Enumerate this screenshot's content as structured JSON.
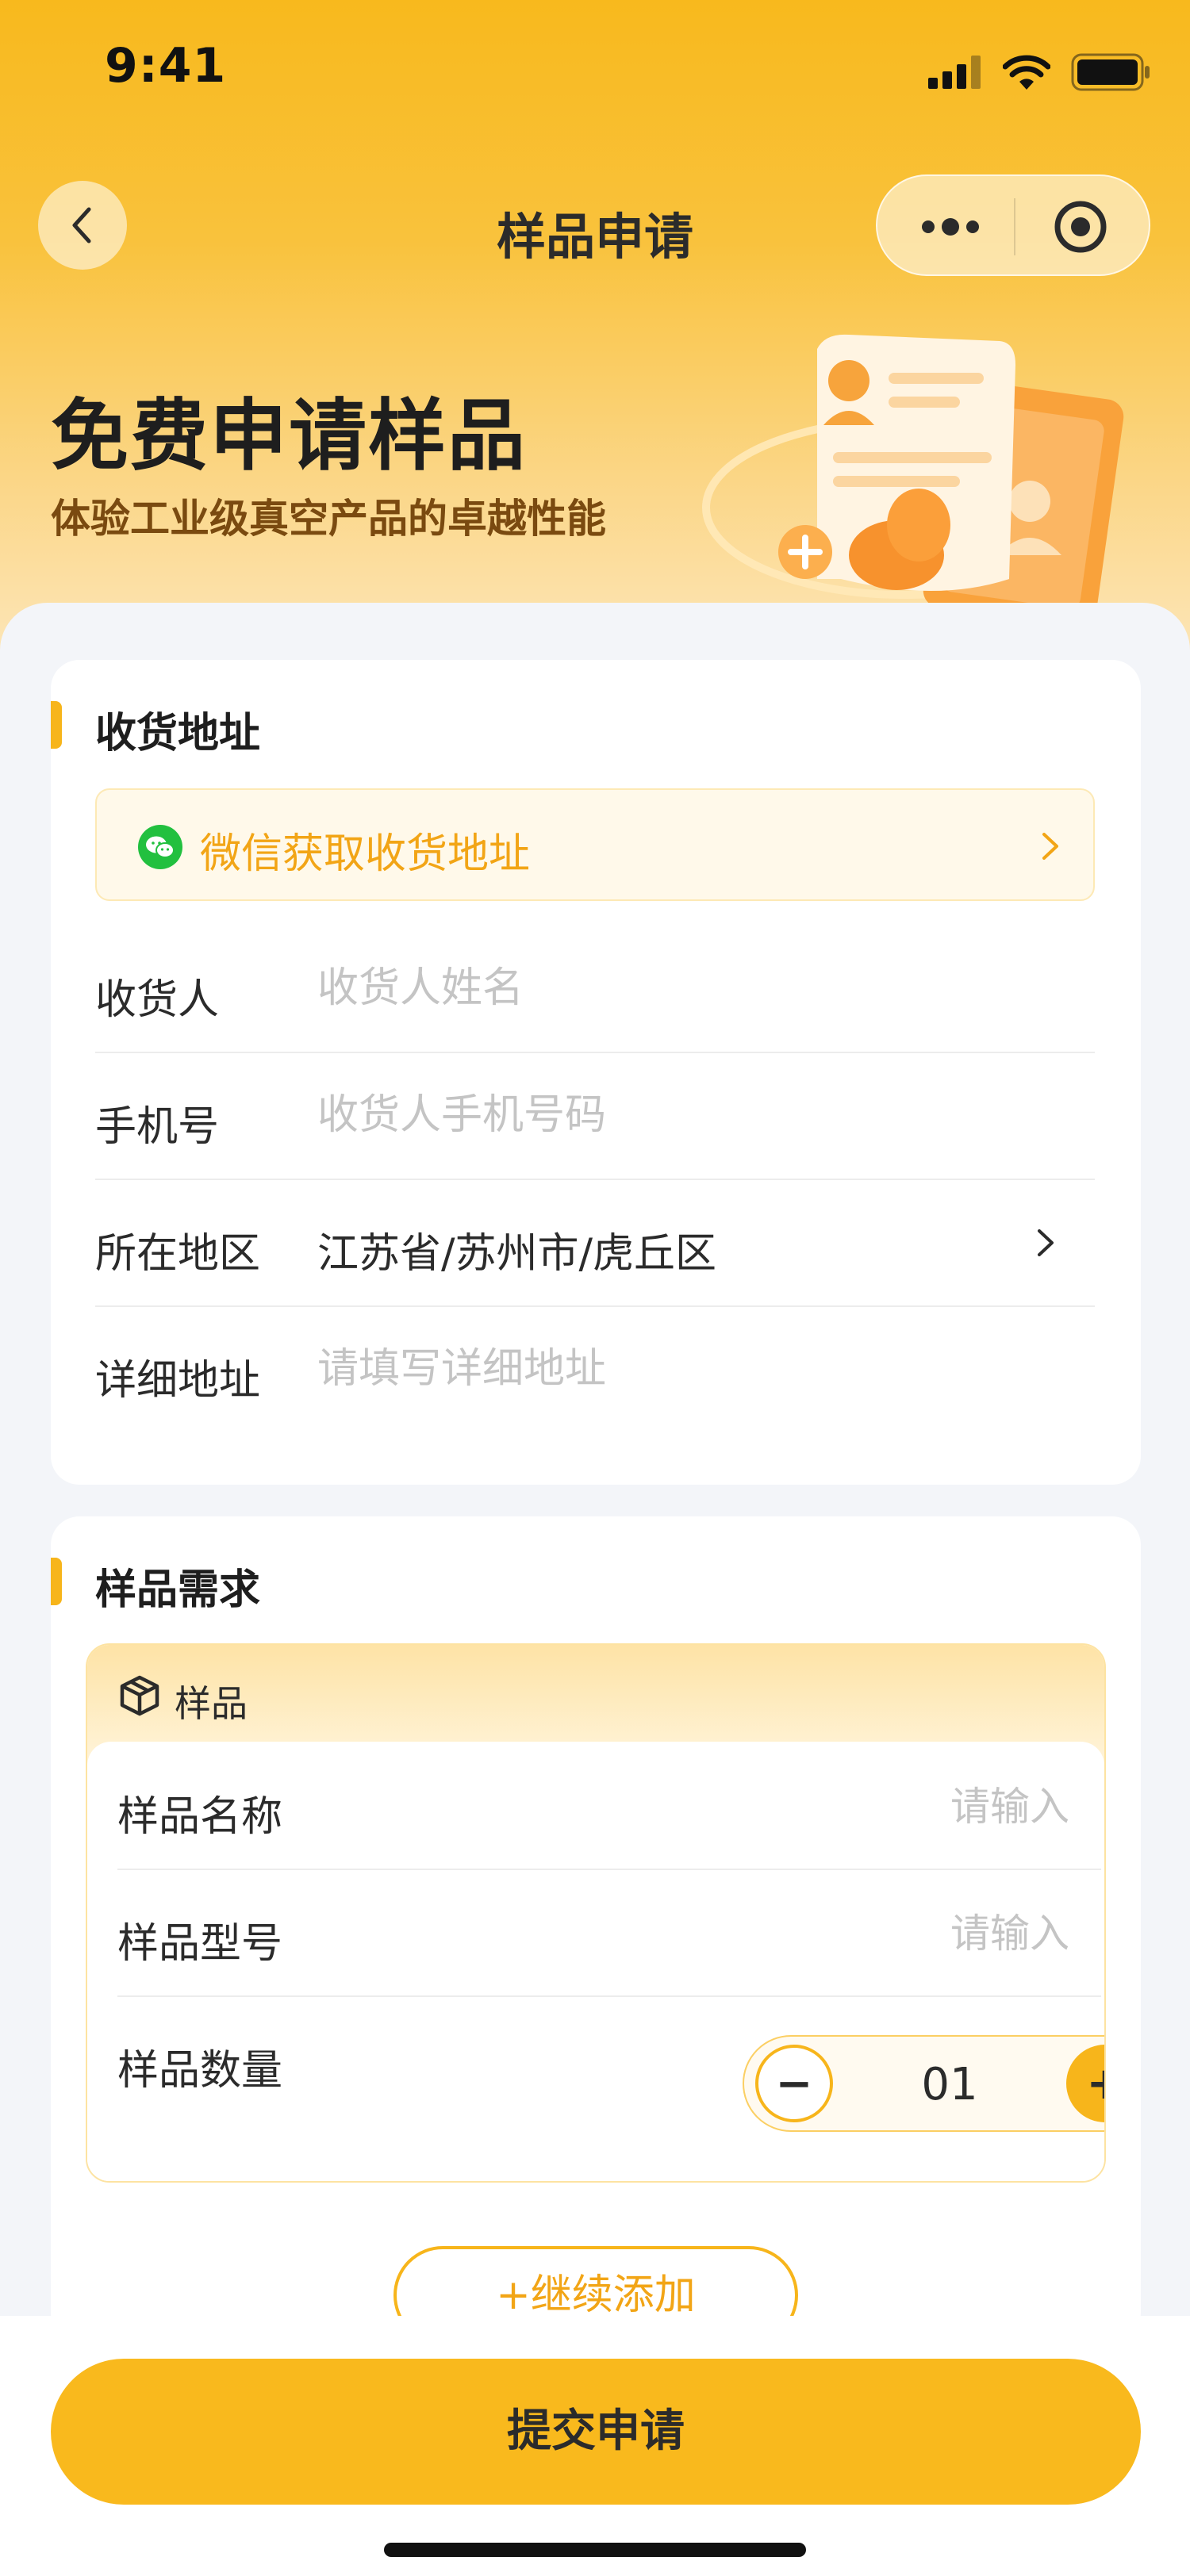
{
  "status_bar": {
    "time": "9:41"
  },
  "nav": {
    "title": "样品申请"
  },
  "hero": {
    "title": "免费申请样品",
    "subtitle": "体验工业级真空产品的卓越性能"
  },
  "address": {
    "section_title": "收货地址",
    "wechat_label": "微信获取收货地址",
    "fields": [
      {
        "label": "收货人",
        "value": "",
        "placeholder": "收货人姓名"
      },
      {
        "label": "手机号",
        "value": "",
        "placeholder": "收货人手机号码"
      },
      {
        "label": "所在地区",
        "value": "江苏省/苏州市/虎丘区"
      },
      {
        "label": "详细地址",
        "value": "",
        "placeholder": "请填写详细地址"
      }
    ]
  },
  "sample": {
    "section_title": "样品需求",
    "item_title": "样品",
    "fields": [
      {
        "label": "样品名称",
        "placeholder": "请输入"
      },
      {
        "label": "样品型号",
        "placeholder": "请输入"
      },
      {
        "label": "样品数量",
        "quantity": "01"
      }
    ],
    "minus_label": "−",
    "plus_label": "+",
    "add_more_label": "+继续添加"
  },
  "footer": {
    "submit_label": "提交申请"
  },
  "colors": {
    "accent": "#f9b91d",
    "accent_text": "#f2a516",
    "wechat_green": "#22c03f"
  }
}
